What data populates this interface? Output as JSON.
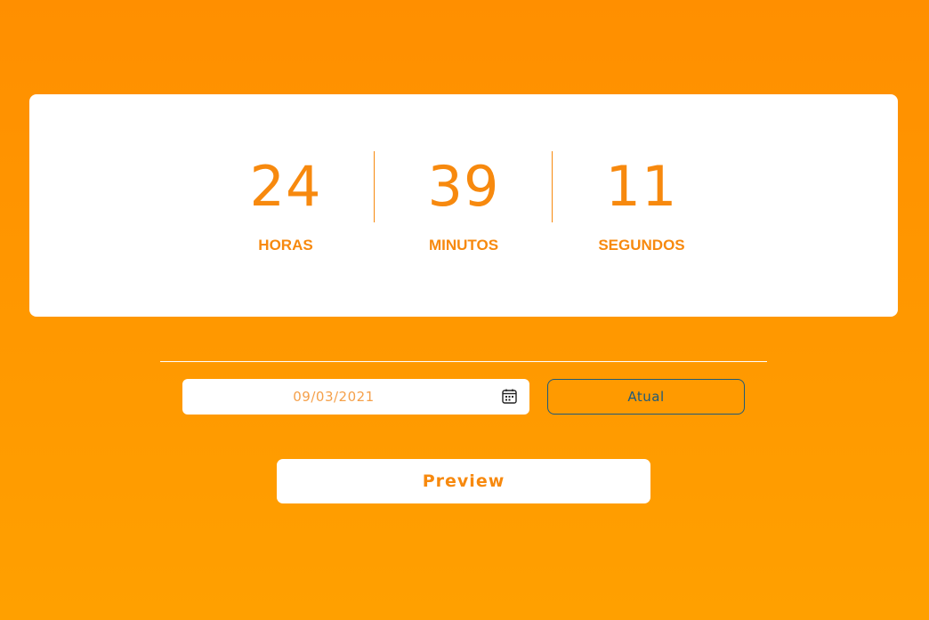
{
  "countdown": {
    "hours": {
      "value": "24",
      "label": "HORAS"
    },
    "minutes": {
      "value": "39",
      "label": "MINUTOS"
    },
    "seconds": {
      "value": "11",
      "label": "SEGUNDOS"
    }
  },
  "controls": {
    "date_value": "09/03/2021",
    "calendar_icon": "calendar-icon",
    "atual_label": "Atual",
    "preview_label": "Preview"
  },
  "colors": {
    "background_top": "#ff8f00",
    "background_bottom": "#ffa000",
    "accent": "#f7890e",
    "button_border": "#1e5a7a"
  }
}
